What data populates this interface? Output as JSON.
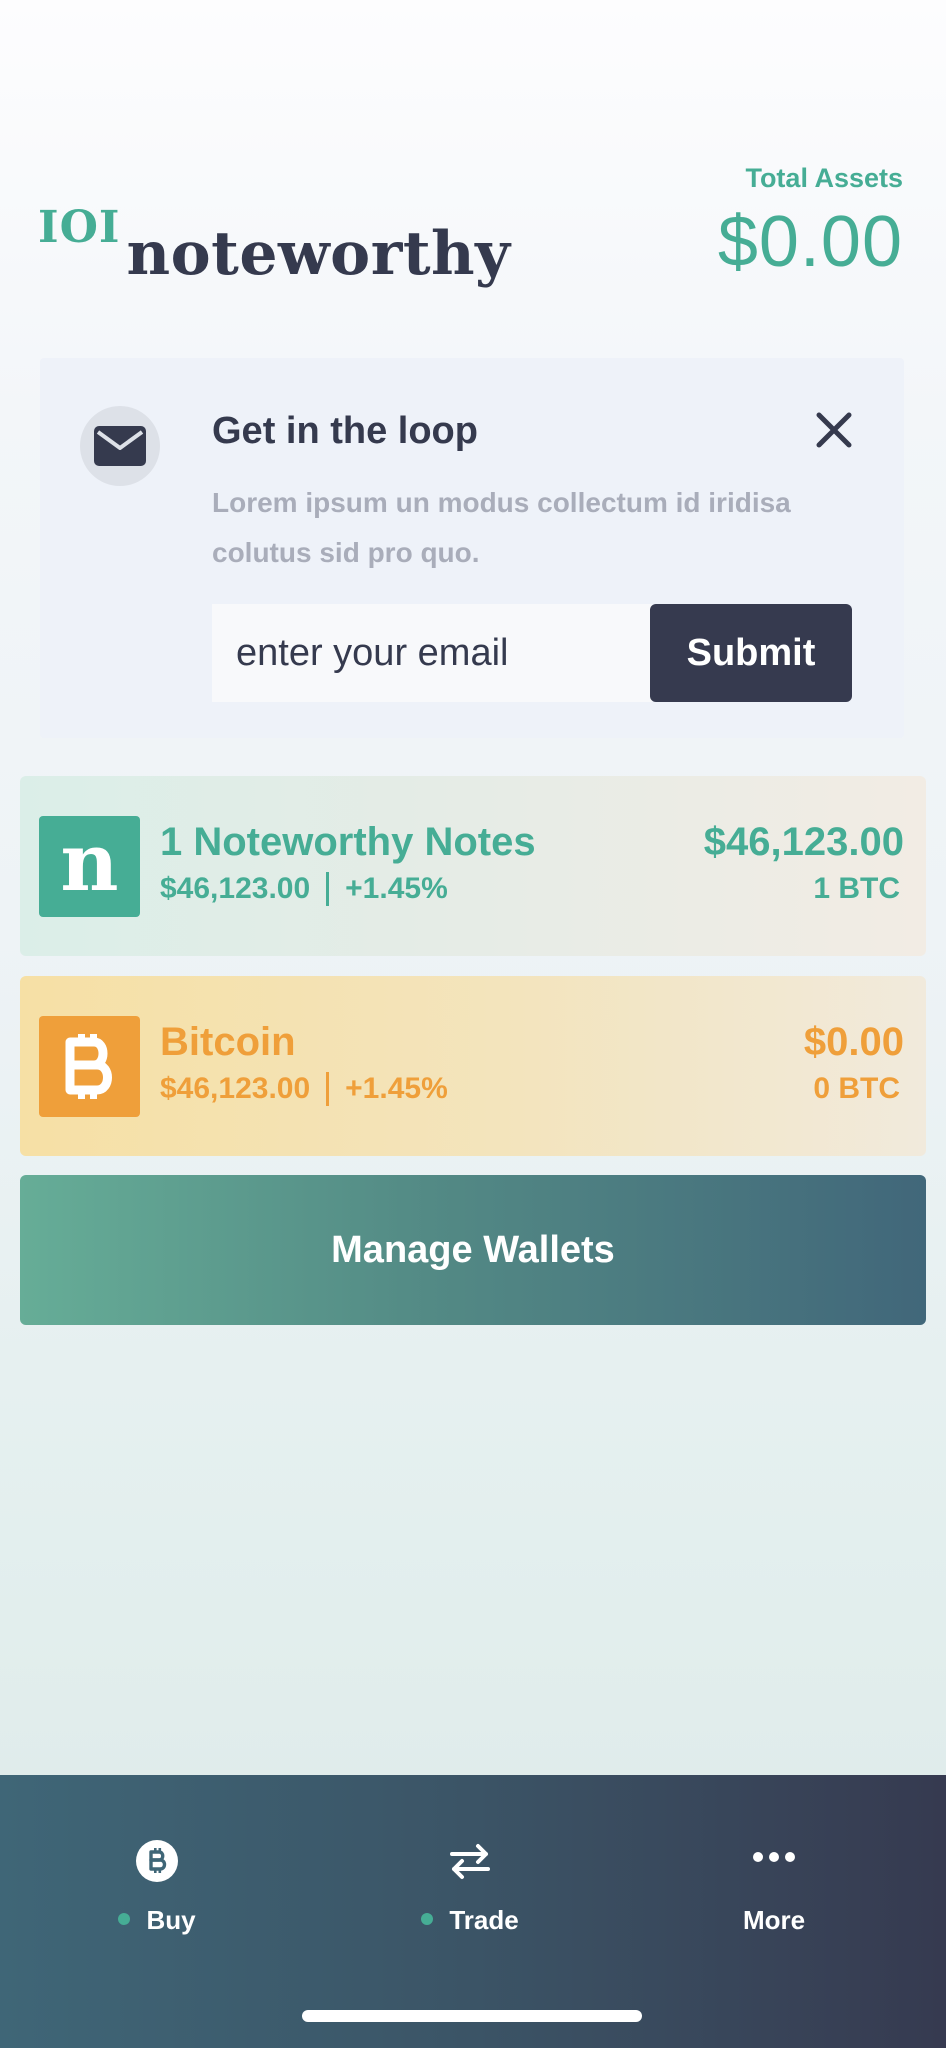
{
  "header": {
    "logo_mark": "IOI",
    "logo_word": "noteworthy",
    "total_assets_label": "Total Assets",
    "total_assets_value": "$0.00"
  },
  "newsletter": {
    "icon": "envelope-icon",
    "title": "Get in the loop",
    "description": "Lorem ipsum un modus collectum id iridisa colutus sid pro quo.",
    "email_placeholder": "enter your email",
    "submit_label": "Submit",
    "close_icon": "close-icon"
  },
  "assets": [
    {
      "icon_letter": "n",
      "icon": "noteworthy-n-icon",
      "name": "1 Noteworthy Notes",
      "price": "$46,123.00",
      "change": "+1.45%",
      "value": "$46,123.00",
      "quantity": "1 BTC",
      "color": "#46ad95"
    },
    {
      "icon": "bitcoin-icon",
      "name": "Bitcoin",
      "price": "$46,123.00",
      "change": "+1.45%",
      "value": "$0.00",
      "quantity": "0 BTC",
      "color": "#ef9f3a"
    }
  ],
  "manage_wallets_label": "Manage Wallets",
  "tabbar": {
    "tabs": [
      {
        "label": "Buy",
        "icon": "bitcoin-circle-icon",
        "dot": true
      },
      {
        "label": "Trade",
        "icon": "swap-arrows-icon",
        "dot": true
      },
      {
        "label": "More",
        "icon": "more-dots-icon",
        "dot": false
      }
    ]
  },
  "colors": {
    "accent_green": "#46ad95",
    "accent_orange": "#ef9f3a",
    "dark": "#353a4e"
  }
}
